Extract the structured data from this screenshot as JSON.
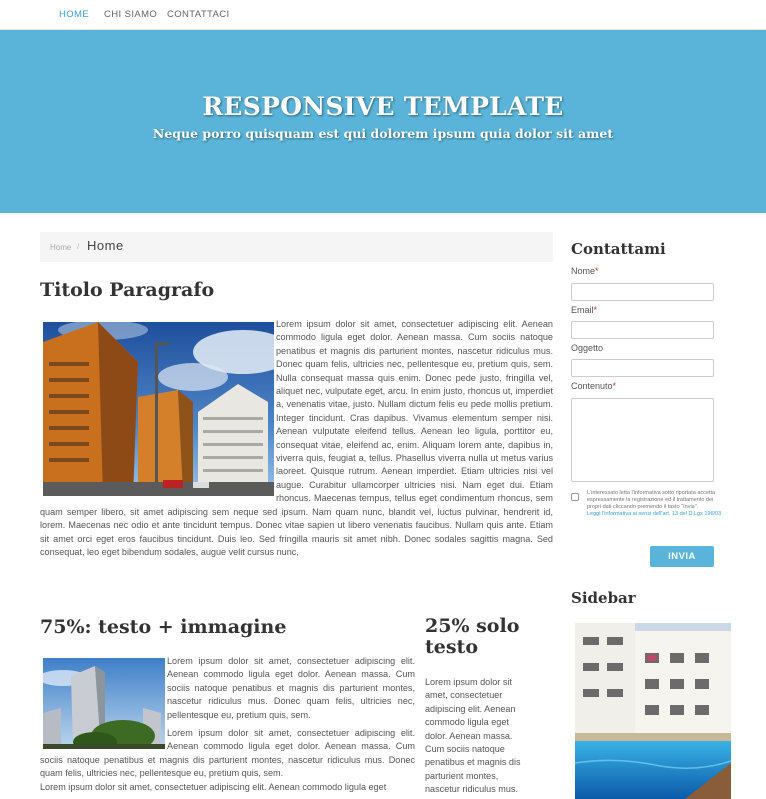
{
  "nav": {
    "items": [
      {
        "label": "HOME",
        "active": true
      },
      {
        "label": "CHI SIAMO",
        "active": false
      },
      {
        "label": "CONTATTACI",
        "active": false
      }
    ]
  },
  "hero": {
    "title": "RESPONSIVE TEMPLATE",
    "subtitle": "Neque porro quisquam est qui dolorem ipsum quia dolor sit amet"
  },
  "breadcrumb": {
    "small": "Home",
    "separator": "/",
    "current": "Home"
  },
  "section1": {
    "title": "Titolo Paragrafo",
    "text": "Lorem ipsum dolor sit amet, consectetuer adipiscing elit. Aenean commodo ligula eget dolor. Aenean massa. Cum sociis natoque penatibus et magnis dis parturient montes, nascetur ridiculus mus. Donec quam felis, ultricies nec, pellentesque eu, pretium quis, sem. Nulla consequat massa quis enim. Donec pede justo, fringilla vel, aliquet nec, vulputate eget, arcu. In enim justo, rhoncus ut, imperdiet a, venenatis vitae, justo. Nullam dictum felis eu pede mollis pretium. Integer tincidunt. Cras dapibus. Vivamus elementum semper nisi. Aenean vulputate eleifend tellus. Aenean leo ligula, porttitor eu, consequat vitae, eleifend ac, enim. Aliquam lorem ante, dapibus in, viverra quis, feugiat a, tellus. Phasellus viverra nulla ut metus varius laoreet. Quisque rutrum. Aenean imperdiet. Etiam ultricies nisi vel augue. Curabitur ullamcorper ultricies nisi. Nam eget dui. Etiam rhoncus. Maecenas tempus, tellus eget condimentum rhoncus, sem quam semper libero, sit amet adipiscing sem neque sed ipsum. Nam quam nunc, blandit vel, luctus pulvinar, hendrerit id, lorem. Maecenas nec odio et ante tincidunt tempus. Donec vitae sapien ut libero venenatis faucibus. Nullam quis ante. Etiam sit amet orci eget eros faucibus tincidunt. Duis leo. Sed fringilla mauris sit amet nibh. Donec sodales sagittis magna. Sed consequat, leo eget bibendum sodales, augue velit cursus nunc,"
  },
  "section2": {
    "title": "75%: testo + immagine",
    "para1": "Lorem ipsum dolor sit amet, consectetuer adipiscing elit. Aenean commodo ligula eget dolor. Aenean massa. Cum sociis natoque penatibus et magnis dis parturient montes, nascetur ridiculus mus. Donec quam felis, ultricies nec, pellentesque eu, pretium quis, sem.",
    "para2": "Lorem ipsum dolor sit amet, consectetuer adipiscing elit. Aenean commodo ligula eget dolor. Aenean massa. Cum sociis natoque penatibus et magnis dis parturient montes, nascetur ridiculus mus. Donec quam felis, ultricies nec, pellentesque eu, pretium quis, sem.",
    "para3": "Lorem ipsum dolor sit amet, consectetuer adipiscing elit. Aenean commodo ligula eget"
  },
  "section3": {
    "title": "25% solo testo",
    "text": "Lorem ipsum dolor sit amet, consectetuer adipiscing elit. Aenean commodo ligula eget dolor. Aenean massa. Cum sociis natoque penatibus et magnis dis parturient montes, nascetur ridiculus mus."
  },
  "contact": {
    "title": "Contattami",
    "fields": {
      "name_label": "Nome",
      "email_label": "Email",
      "subject_label": "Oggetto",
      "content_label": "Contenuto",
      "required_mark": "*"
    },
    "privacy_text": "L'interessato letta l'informativa sotto riportata accetta espressamente la registrazione ed il trattamento dei propri dati cliccando premendo il tasto \"Invia\".",
    "privacy_link": "Leggi l'informativa ai sensi dell'art. 13 del D.Lgs 196/03",
    "submit_label": "INVIA"
  },
  "sidebar": {
    "title": "Sidebar"
  },
  "colors": {
    "accent": "#5ab4d9",
    "nav_active": "#3aa0d0",
    "required": "#c0392b"
  }
}
